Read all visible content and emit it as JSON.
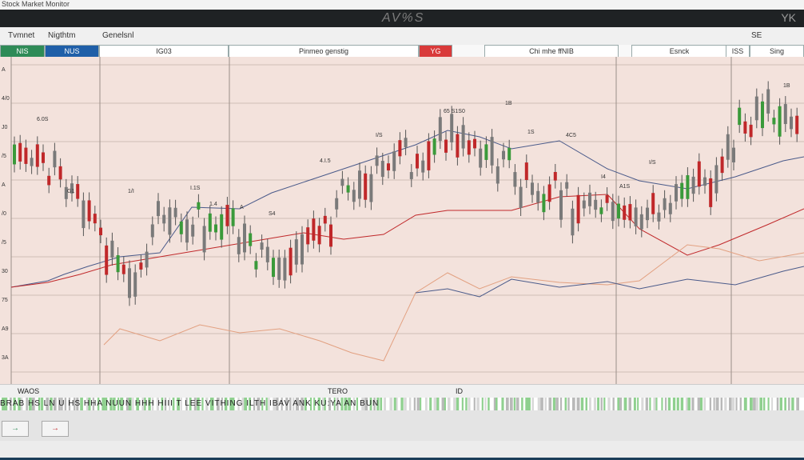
{
  "window": {
    "title": "Stock Market Monitor"
  },
  "header": {
    "logo_text": "AV%S",
    "corner_text": "YK"
  },
  "menu": {
    "items": [
      "Tvmnet",
      "Nigthtm",
      "Genelsnl"
    ],
    "right_text": "SE"
  },
  "tabs": [
    {
      "label": "NIS",
      "bg": "#2e8b57",
      "fg": "#ffffff"
    },
    {
      "label": "NUS",
      "bg": "#1f5fa8",
      "fg": "#ffffff"
    },
    {
      "label": "IG03",
      "bg": "#ffffff",
      "fg": "#333333"
    },
    {
      "label": "Pinmeo genstig",
      "bg": "#ffffff",
      "fg": "#333333"
    },
    {
      "label": "YG",
      "bg": "#d93a3a",
      "fg": "#ffffff"
    },
    {
      "label": "Chi mhe ffNIB",
      "bg": "#ffffff",
      "fg": "#333333"
    },
    {
      "label": "Esnck",
      "bg": "#ffffff",
      "fg": "#333333"
    },
    {
      "label": "ISS",
      "bg": "#ffffff",
      "fg": "#333333"
    },
    {
      "label": "Sing",
      "bg": "#ffffff",
      "fg": "#333333"
    }
  ],
  "chart": {
    "y_labels": [
      "A",
      "4/0",
      "J0",
      "/5",
      "A",
      "/0",
      "/5",
      "30",
      "75",
      "A9",
      "3A"
    ],
    "annotations": [
      "6.0S",
      "65 S1S0",
      "I/S",
      "4.I.5",
      "I.1S",
      "1.4",
      "4C5",
      "I/S",
      "1B",
      "1S",
      "1B",
      "S4",
      "A1S",
      "G1",
      "1/I",
      "I4",
      "A"
    ]
  },
  "bottom": {
    "left": "WAOS",
    "center": "TERO",
    "right": "ID"
  },
  "ticker": {
    "text": "BRAB HS LN U HS HHA NUUN HHH HIII T LEE VITHING ILTH IBAV ANK KU:YA AN BUN"
  },
  "toolbar": {
    "buttons": [
      "→",
      "→"
    ]
  },
  "colors": {
    "up": "#7a7a7a",
    "down": "#c0282a",
    "green": "#3a9a3a",
    "bg": "#f3e2dc",
    "grid": "#cfbdb6",
    "line_blue": "#4a5a8a",
    "line_red": "#c0282a",
    "line_orange": "#e2a080"
  }
}
